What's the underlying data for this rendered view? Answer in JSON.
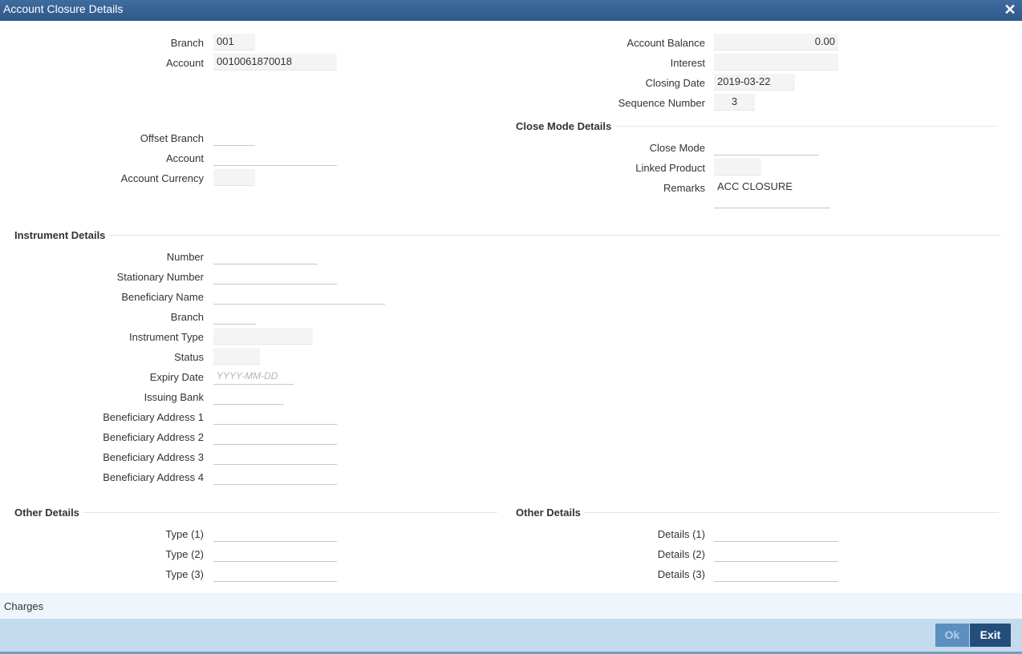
{
  "window": {
    "title": "Account Closure Details"
  },
  "account": {
    "branch_label": "Branch",
    "branch": "001",
    "account_label": "Account",
    "account": "0010061870018",
    "balance_label": "Account Balance",
    "balance": "0.00",
    "interest_label": "Interest",
    "interest": "",
    "closing_date_label": "Closing Date",
    "closing_date": "2019-03-22",
    "sequence_label": "Sequence Number",
    "sequence": "3"
  },
  "offset": {
    "branch_label": "Offset Branch",
    "branch": "",
    "account_label": "Account",
    "account": "",
    "currency_label": "Account Currency",
    "currency": ""
  },
  "close_mode": {
    "title": "Close Mode Details",
    "mode_label": "Close Mode",
    "mode": "",
    "linked_product_label": "Linked Product",
    "linked_product": "",
    "remarks_label": "Remarks",
    "remarks": "ACC CLOSURE"
  },
  "instrument": {
    "title": "Instrument Details",
    "number_label": "Number",
    "number": "",
    "stationary_label": "Stationary Number",
    "stationary": "",
    "beneficiary_name_label": "Beneficiary Name",
    "beneficiary_name": "",
    "branch_label": "Branch",
    "branch": "",
    "type_label": "Instrument Type",
    "type": "",
    "status_label": "Status",
    "status": "",
    "expiry_label": "Expiry Date",
    "expiry_placeholder": "YYYY-MM-DD",
    "issuing_bank_label": "Issuing Bank",
    "issuing_bank": "",
    "addr1_label": "Beneficiary Address 1",
    "addr1": "",
    "addr2_label": "Beneficiary Address 2",
    "addr2": "",
    "addr3_label": "Beneficiary Address 3",
    "addr3": "",
    "addr4_label": "Beneficiary Address 4",
    "addr4": ""
  },
  "other_left": {
    "title": "Other Details",
    "type1_label": "Type (1)",
    "type1": "",
    "type2_label": "Type (2)",
    "type2": "",
    "type3_label": "Type (3)",
    "type3": ""
  },
  "other_right": {
    "title": "Other Details",
    "details1_label": "Details (1)",
    "details1": "",
    "details2_label": "Details (2)",
    "details2": "",
    "details3_label": "Details (3)",
    "details3": ""
  },
  "charges": {
    "label": "Charges"
  },
  "footer": {
    "ok_label": "Ok",
    "exit_label": "Exit"
  },
  "colors": {
    "titlebar": "#2e5889",
    "footer": "#c4dbee",
    "exit_button": "#234e7c",
    "ok_button": "#5c8fbf"
  },
  "icons": {
    "close": "close-icon"
  }
}
